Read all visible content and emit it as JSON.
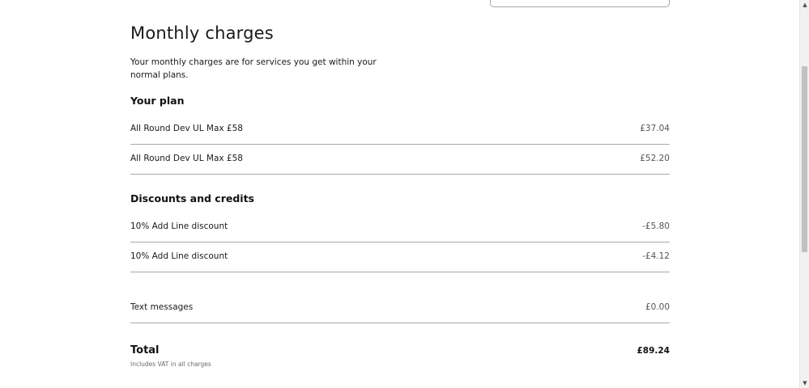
{
  "page": {
    "title": "Monthly charges",
    "intro": "Your monthly charges are for services you get within your normal plans."
  },
  "your_plan": {
    "heading": "Your plan",
    "items": [
      {
        "label": "All Round Dev UL Max £58",
        "amount": "£37.04"
      },
      {
        "label": "All Round Dev UL Max £58",
        "amount": "£52.20"
      }
    ]
  },
  "discounts": {
    "heading": "Discounts and credits",
    "items": [
      {
        "label": "10% Add Line discount",
        "amount": "-£5.80"
      },
      {
        "label": "10% Add Line discount",
        "amount": "-£4.12"
      }
    ]
  },
  "other": {
    "items": [
      {
        "label": "Text messages",
        "amount": "£0.00"
      }
    ]
  },
  "total": {
    "label": "Total",
    "amount": "£89.24",
    "note": "Includes VAT in all charges"
  },
  "scrollbar": {
    "up_icon": "triangle-up-icon",
    "down_icon": "triangle-down-icon"
  }
}
